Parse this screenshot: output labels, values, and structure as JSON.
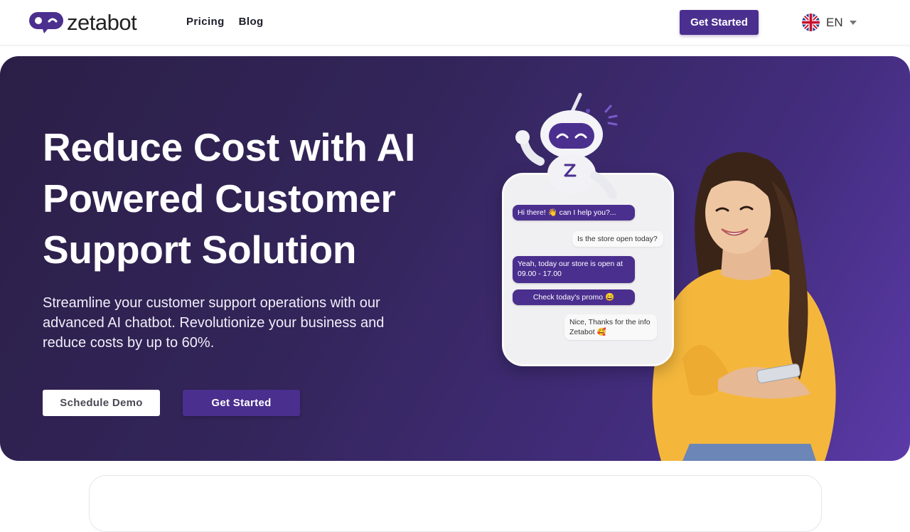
{
  "brand": {
    "name": "zetabot",
    "accent": "#4b2f8f"
  },
  "nav": {
    "items": [
      {
        "label": "Pricing"
      },
      {
        "label": "Blog"
      }
    ]
  },
  "header": {
    "cta_label": "Get Started",
    "language": "EN",
    "language_flag": "uk-flag-icon"
  },
  "hero": {
    "title": "Reduce Cost with AI Powered Customer Support Solution",
    "subtitle": "Streamline your customer support operations with our advanced AI chatbot. Revolutionize your business and reduce costs by up to 60%.",
    "secondary_cta": "Schedule Demo",
    "primary_cta": "Get Started",
    "gradient": [
      "#2b1f47",
      "#5b3aa8"
    ]
  },
  "chat": {
    "messages": [
      {
        "from": "bot",
        "text": "Hi there! 👋 can I help you?..."
      },
      {
        "from": "user",
        "text": "Is the store open today?"
      },
      {
        "from": "bot",
        "text": "Yeah, today our store is open at 09.00 - 17.00"
      },
      {
        "from": "bot",
        "text": "Check today's promo 😄"
      },
      {
        "from": "user",
        "text": "Nice, Thanks for the info Zetabot 🥰"
      }
    ]
  }
}
